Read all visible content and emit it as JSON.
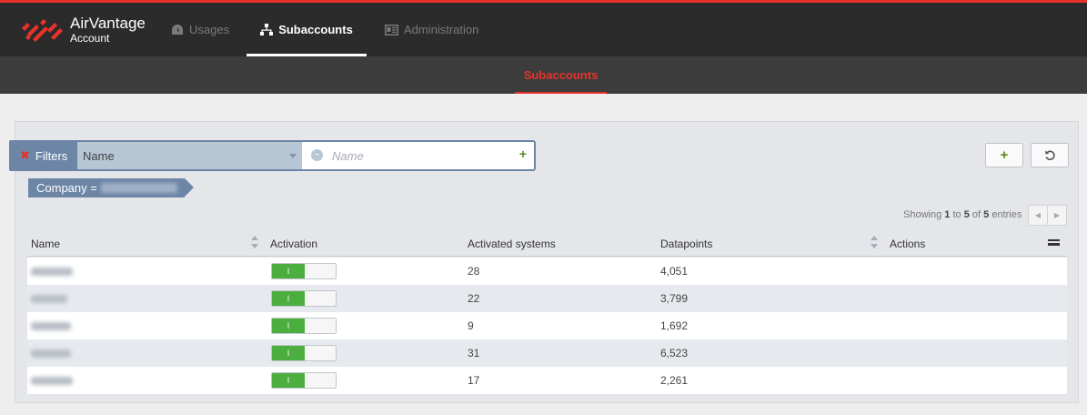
{
  "brand": {
    "name": "AirVantage",
    "sub": "Account"
  },
  "nav": [
    {
      "label": "Usages",
      "icon": "dashboard-icon",
      "active": false
    },
    {
      "label": "Subaccounts",
      "icon": "hierarchy-icon",
      "active": true
    },
    {
      "label": "Administration",
      "icon": "id-card-icon",
      "active": false
    }
  ],
  "subnav": {
    "active_tab": "Subaccounts"
  },
  "filters": {
    "label": "Filters",
    "field": "Name",
    "input_placeholder": "Name",
    "chip_label": "Company ="
  },
  "toolbar": {
    "add_label": "+"
  },
  "pagination": {
    "prefix": "Showing",
    "from": "1",
    "to_word": "to",
    "to": "5",
    "of_word": "of",
    "total": "5",
    "suffix": "entries"
  },
  "table": {
    "columns": [
      "Name",
      "Activation",
      "Activated systems",
      "Datapoints",
      "Actions"
    ],
    "rows": [
      {
        "activation": "I",
        "activated_systems": "28",
        "datapoints": "4,051"
      },
      {
        "activation": "I",
        "activated_systems": "22",
        "datapoints": "3,799"
      },
      {
        "activation": "I",
        "activated_systems": "9",
        "datapoints": "1,692"
      },
      {
        "activation": "I",
        "activated_systems": "31",
        "datapoints": "6,523"
      },
      {
        "activation": "I",
        "activated_systems": "17",
        "datapoints": "2,261"
      }
    ]
  },
  "colors": {
    "accent": "#e6332a",
    "filter_blue": "#6d86a6",
    "toggle_on": "#4cae3f"
  }
}
